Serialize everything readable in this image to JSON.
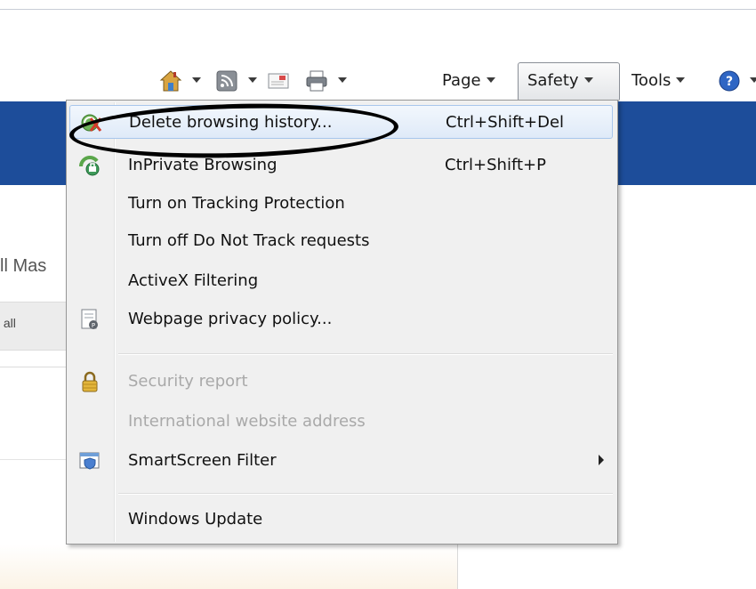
{
  "toolbar": {
    "icons": [
      "home-icon",
      "feeds-icon",
      "read-mail-icon",
      "print-icon",
      "help-icon"
    ],
    "page_label": "Page",
    "safety_label": "Safety",
    "tools_label": "Tools"
  },
  "background": {
    "partial_heading": "ll Mas",
    "partial_tab": " all"
  },
  "safety_menu": {
    "items": [
      {
        "label": "Delete browsing history...",
        "shortcut": "Ctrl+Shift+Del",
        "icon": "delete-history-icon",
        "enabled": true,
        "highlighted": true
      },
      {
        "label": "InPrivate Browsing",
        "shortcut": "Ctrl+Shift+P",
        "icon": "inprivate-icon",
        "enabled": true
      },
      {
        "label": "Turn on Tracking Protection",
        "shortcut": "",
        "enabled": true
      },
      {
        "label": "Turn off Do Not Track requests",
        "shortcut": "",
        "enabled": true
      },
      {
        "label": "ActiveX Filtering",
        "shortcut": "",
        "enabled": true
      },
      {
        "label": "Webpage privacy policy...",
        "shortcut": "",
        "icon": "privacy-policy-icon",
        "enabled": true
      },
      {
        "label": "Security report",
        "shortcut": "",
        "icon": "lock-icon",
        "enabled": false
      },
      {
        "label": "International website address",
        "shortcut": "",
        "enabled": false
      },
      {
        "label": "SmartScreen Filter",
        "shortcut": "",
        "icon": "smartscreen-icon",
        "enabled": true,
        "submenu": true
      },
      {
        "label": "Windows Update",
        "shortcut": "",
        "enabled": true
      }
    ]
  },
  "colors": {
    "blue_band": "#1d4d9a",
    "menu_bg": "#f0f0f0",
    "highlight_border": "#a8c6ec",
    "disabled_text": "#a9a9a9",
    "annotation_circle": "#000000"
  }
}
